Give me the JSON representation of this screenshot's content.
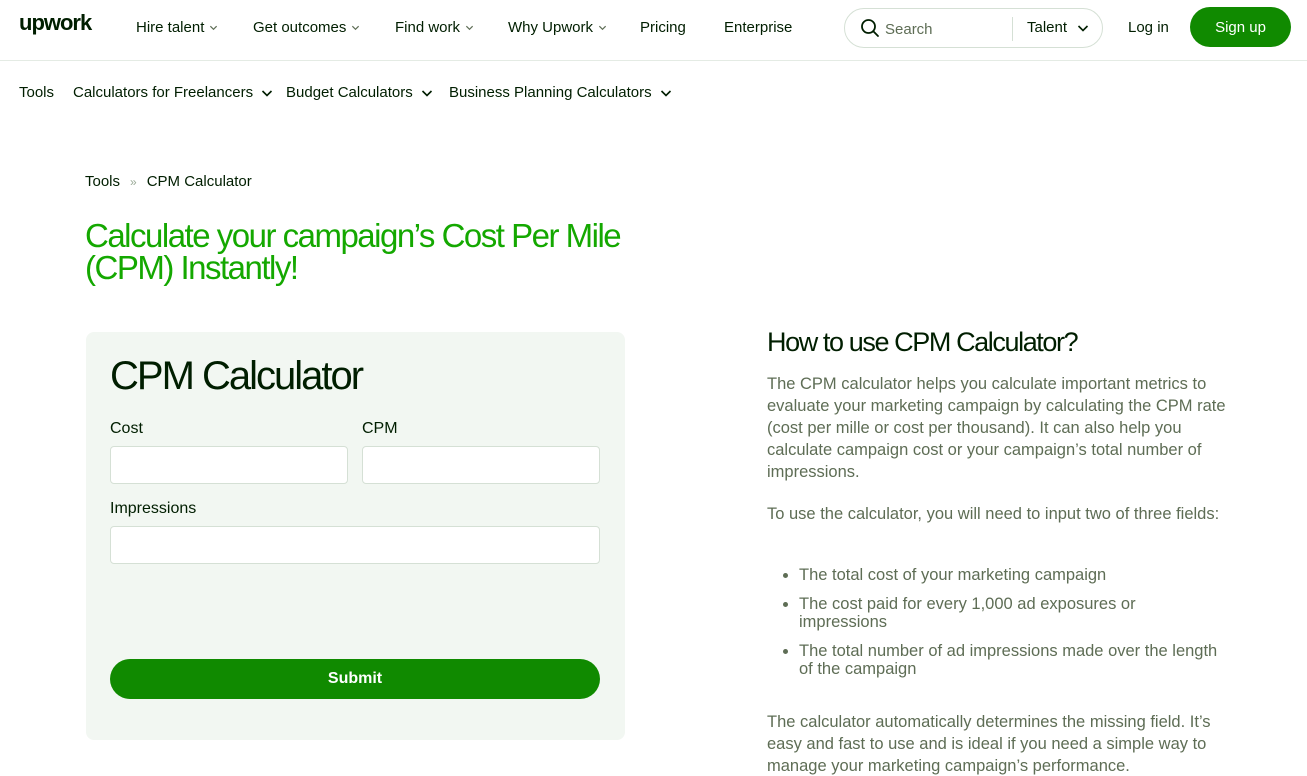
{
  "brand": {
    "name": "upwork",
    "accent": "#108a00",
    "title_green": "#14a800"
  },
  "topnav": {
    "items": [
      {
        "label": "Hire talent",
        "has_dropdown": true
      },
      {
        "label": "Get outcomes",
        "has_dropdown": true
      },
      {
        "label": "Find work",
        "has_dropdown": true
      },
      {
        "label": "Why Upwork",
        "has_dropdown": true
      },
      {
        "label": "Pricing",
        "has_dropdown": false
      },
      {
        "label": "Enterprise",
        "has_dropdown": false
      }
    ],
    "search": {
      "placeholder": "Search",
      "scope": "Talent"
    },
    "login": "Log in",
    "signup": "Sign up"
  },
  "subnav": {
    "items": [
      {
        "label": "Tools"
      },
      {
        "label": "Calculators for Freelancers"
      },
      {
        "label": "Budget Calculators"
      },
      {
        "label": "Business Planning Calculators"
      }
    ]
  },
  "breadcrumb": {
    "items": [
      "Tools",
      "CPM Calculator"
    ],
    "separator": "»"
  },
  "hero": {
    "title": "Calculate your campaign’s Cost Per Mile (CPM) Instantly!"
  },
  "calculator": {
    "title": "CPM Calculator",
    "fields": [
      {
        "label": "Cost",
        "value": ""
      },
      {
        "label": "CPM",
        "value": ""
      },
      {
        "label": "Impressions",
        "value": ""
      }
    ],
    "submit": "Submit"
  },
  "howto": {
    "title": "How to use CPM Calculator?",
    "paragraphs": [
      "The CPM calculator helps you calculate important metrics to evaluate your marketing campaign by calculating the CPM rate (cost per mille or cost per thousand). It can also help you calculate campaign cost or your campaign’s total number of impressions.",
      "To use the calculator, you will need to input two of three fields:",
      "The calculator automatically determines the missing field. It’s easy and fast to use and is ideal if you need a simple way to manage your marketing campaign’s performance."
    ],
    "bullets": [
      "The total cost of your marketing campaign",
      "The cost paid for every 1,000 ad exposures or impressions",
      "The total number of ad impressions made over the length of the campaign"
    ]
  }
}
